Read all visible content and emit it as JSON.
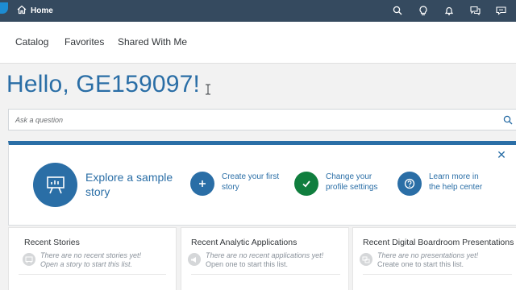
{
  "shell": {
    "home_label": "Home",
    "actions": [
      "search-icon",
      "lightbulb-icon",
      "bell-icon",
      "chat-icon",
      "feedback-icon"
    ]
  },
  "tabs": [
    "Catalog",
    "Favorites",
    "Shared With Me"
  ],
  "greeting": "Hello, GE159097!",
  "search": {
    "placeholder": "Ask a question"
  },
  "welcome": {
    "primary": {
      "line1": "Explore a sample",
      "line2": "story"
    },
    "actions": [
      {
        "line1": "Create your first",
        "line2": "story",
        "icon": "plus-icon",
        "color": "#2a6ea6"
      },
      {
        "line1": "Change your",
        "line2": "profile settings",
        "icon": "check-icon",
        "color": "#107e3e"
      },
      {
        "line1": "Learn more in",
        "line2": "the help center",
        "icon": "help-icon",
        "color": "#2a6ea6"
      }
    ]
  },
  "cards": [
    {
      "title": "Recent Stories",
      "empty_line1": "There are no recent stories yet!",
      "empty_line2": "Open a story to start this list."
    },
    {
      "title": "Recent Analytic Applications",
      "empty_line1": "There are no recent applications yet!",
      "empty_line2": "Open one to start this list."
    },
    {
      "title": "Recent Digital Boardroom Presentations",
      "empty_line1": "There are no presentations yet!",
      "empty_line2": "Create one to start this list."
    }
  ],
  "colors": {
    "shell": "#354a5f",
    "accent": "#2a6ea6",
    "success": "#107e3e"
  }
}
